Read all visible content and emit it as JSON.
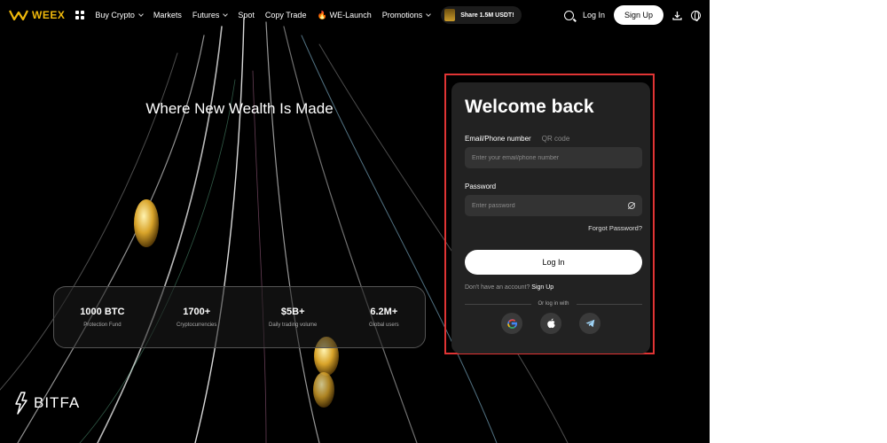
{
  "nav": {
    "brand": "WEEX",
    "items": [
      {
        "label": "Buy Crypto",
        "has_dropdown": true
      },
      {
        "label": "Markets",
        "has_dropdown": false
      },
      {
        "label": "Futures",
        "has_dropdown": true
      },
      {
        "label": "Spot",
        "has_dropdown": false
      },
      {
        "label": "Copy Trade",
        "has_dropdown": false
      },
      {
        "label": "WE-Launch",
        "has_dropdown": false,
        "icon": "fire-icon"
      },
      {
        "label": "Promotions",
        "has_dropdown": true
      }
    ],
    "promo_pill": "Share 1.5M USDT!",
    "login_label": "Log In",
    "signup_label": "Sign Up",
    "icons": [
      "search-icon",
      "download-icon",
      "globe-icon"
    ]
  },
  "hero": {
    "title": "Where New Wealth Is Made"
  },
  "stats": [
    {
      "value": "1000 BTC",
      "label": "Protection Fund"
    },
    {
      "value": "1700+",
      "label": "Cryptocurrencies"
    },
    {
      "value": "$5B+",
      "label": "Daily trading volume"
    },
    {
      "value": "6.2M+",
      "label": "Global users"
    }
  ],
  "watermark": "BITFA",
  "login": {
    "title": "Welcome back",
    "tab_email": "Email/Phone number",
    "tab_qr": "QR code",
    "email_placeholder": "Enter your email/phone number",
    "password_label": "Password",
    "password_placeholder": "Enter password",
    "forgot": "Forgot Password?",
    "login_button": "Log In",
    "no_account_text": "Don't have an account?",
    "signup_link": "Sign Up",
    "or_login_with": "Or log in with",
    "socials": [
      "google-icon",
      "apple-icon",
      "telegram-icon"
    ]
  },
  "colors": {
    "brand": "#f0b90b",
    "highlight": "#e03434",
    "card_bg": "#222222"
  }
}
